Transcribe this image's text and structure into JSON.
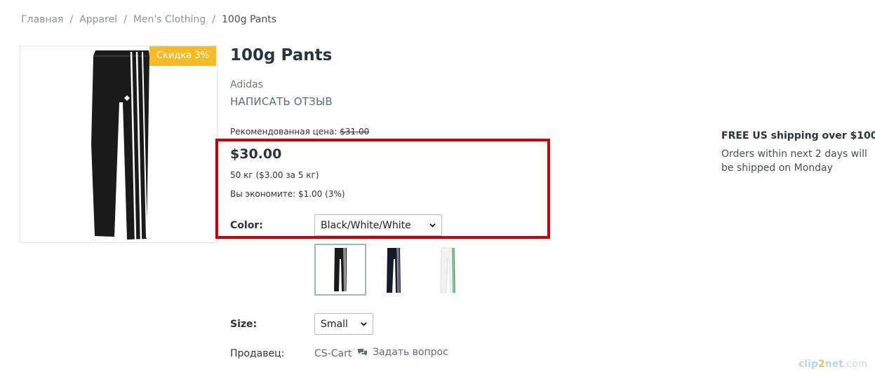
{
  "breadcrumb": {
    "items": [
      "Главная",
      "Apparel",
      "Men's Clothing"
    ],
    "current": "100g Pants",
    "separator": "/"
  },
  "product": {
    "title": "100g Pants",
    "brand": "Adidas",
    "review_link": "НАПИСАТЬ ОТЗЫВ",
    "discount_badge": "Скидка 3%",
    "list_price_label": "Рекомендованная цена:",
    "list_price": "$31.00",
    "price": "$30.00",
    "unit_price": "50 кг ($3.00 за 5 кг)",
    "savings": "Вы экономите: $1.00 (3%)"
  },
  "options": {
    "color_label": "Color:",
    "color_value": "Black/White/White",
    "color_variants": [
      "black",
      "navy",
      "white"
    ],
    "size_label": "Size:",
    "size_value": "Small"
  },
  "seller": {
    "label": "Продавец:",
    "name": "CS-Cart",
    "ask_question": "Задать вопрос"
  },
  "shipping": {
    "title": "FREE US shipping over $100!",
    "text": "Orders within next 2 days will be shipped on Monday"
  },
  "watermark": {
    "part1": "clip",
    "part2": "2",
    "part3": "net",
    "part4": ".com"
  },
  "colors": {
    "badge": "#f8bb25",
    "highlight": "#cc0000",
    "link": "#5a6c80"
  }
}
